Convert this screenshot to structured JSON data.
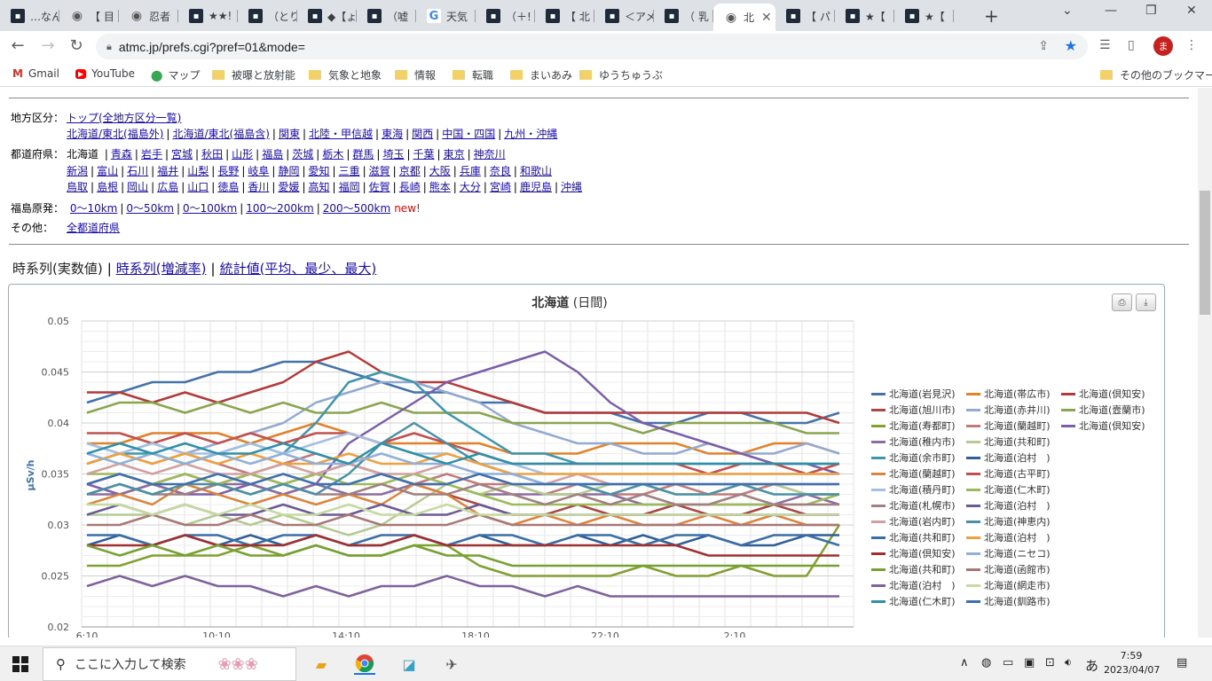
{
  "browser": {
    "tabs": [
      {
        "title": "…なん",
        "icon": "site-icon"
      },
      {
        "title": "【 目",
        "icon": "globe-icon"
      },
      {
        "title": "忍者",
        "icon": "globe-icon"
      },
      {
        "title": "★★!",
        "icon": "site-icon"
      },
      {
        "title": "（とり",
        "icon": "site-icon"
      },
      {
        "title": "◆【ょ",
        "icon": "site-icon"
      },
      {
        "title": "（嘘",
        "icon": "site-icon"
      },
      {
        "title": "天気",
        "icon": "google-icon"
      },
      {
        "title": "（＋!",
        "icon": "site-icon"
      },
      {
        "title": "【 北",
        "icon": "site-icon"
      },
      {
        "title": "＜アメ",
        "icon": "site-icon"
      },
      {
        "title": "（ 乳",
        "icon": "site-icon"
      },
      {
        "title": "北",
        "icon": "globe-icon",
        "active": true
      },
      {
        "title": "【 パ",
        "icon": "site-icon"
      },
      {
        "title": "★【",
        "icon": "site-icon"
      },
      {
        "title": "★【",
        "icon": "site-icon"
      }
    ],
    "url": "atmc.jp/prefs.cgi?pref=01&mode=",
    "avatar_initial": "ま",
    "bookmarks": [
      {
        "label": "Gmail",
        "icon": "gmail-icon"
      },
      {
        "label": "YouTube",
        "icon": "youtube-icon"
      },
      {
        "label": "マップ",
        "icon": "maps-icon"
      },
      {
        "label": "被曝と放射能",
        "icon": "folder-icon"
      },
      {
        "label": "気象と地象",
        "icon": "folder-icon"
      },
      {
        "label": "情報",
        "icon": "folder-icon"
      },
      {
        "label": "転職",
        "icon": "folder-icon"
      },
      {
        "label": "まいあみ",
        "icon": "folder-icon"
      },
      {
        "label": "ゆうちゅうぶ",
        "icon": "folder-icon"
      }
    ],
    "other_bookmarks": "その他のブックマーク"
  },
  "nav": {
    "region_label": "地方区分：",
    "region_top": "トップ(全地方区分一覧)",
    "regions": [
      "北海道/東北(福島外)",
      "北海道/東北(福島含)",
      "関東",
      "北陸・甲信越",
      "東海",
      "関西",
      "中国・四国",
      "九州・沖縄"
    ],
    "pref_label": "都道府県：",
    "pref_current": "北海道",
    "prefs_row1": [
      "青森",
      "岩手",
      "宮城",
      "秋田",
      "山形",
      "福島",
      "茨城",
      "栃木",
      "群馬",
      "埼玉",
      "千葉",
      "東京",
      "神奈川"
    ],
    "prefs_row2": [
      "新潟",
      "富山",
      "石川",
      "福井",
      "山梨",
      "長野",
      "岐阜",
      "静岡",
      "愛知",
      "三重",
      "滋賀",
      "京都",
      "大阪",
      "兵庫",
      "奈良",
      "和歌山"
    ],
    "prefs_row3": [
      "鳥取",
      "島根",
      "岡山",
      "広島",
      "山口",
      "徳島",
      "香川",
      "愛媛",
      "高知",
      "福岡",
      "佐賀",
      "長崎",
      "熊本",
      "大分",
      "宮崎",
      "鹿児島",
      "沖縄"
    ],
    "fukushima_label": "福島原発：",
    "fukushima_ranges": [
      "0〜10km",
      "0〜50km",
      "0〜100km",
      "100〜200km",
      "200〜500km"
    ],
    "new_badge": "new!",
    "other_label": "その他：",
    "other_link": "全都道府県"
  },
  "view_tabs": {
    "current": "時系列(実数値)",
    "links": [
      "時系列(増減率)",
      "統計値(平均、最少、最大)"
    ]
  },
  "chart_data": {
    "type": "line",
    "title": "北海道",
    "subtitle": "(日間)",
    "ylabel": "μSv/h",
    "ylim": [
      0.02,
      0.05
    ],
    "yticks": [
      "0.05",
      "0.045",
      "0.04",
      "0.035",
      "0.03",
      "0.025",
      "0.02"
    ],
    "xticks": [
      "6:10",
      "10:10",
      "14:10",
      "18:10",
      "22:10",
      "2:10"
    ],
    "legend_position": "right",
    "grid": true,
    "series": [
      {
        "name": "北海道(岩見沢)",
        "color": "#4572a7",
        "values": [
          0.042,
          0.043,
          0.044,
          0.044,
          0.045,
          0.045,
          0.046,
          0.046,
          0.045,
          0.044,
          0.043,
          0.043,
          0.042,
          0.042,
          0.041,
          0.041,
          0.041,
          0.04,
          0.04,
          0.041,
          0.041,
          0.04,
          0.04,
          0.041
        ]
      },
      {
        "name": "北海道(帯広市)",
        "color": "#e0822b",
        "values": [
          0.038,
          0.038,
          0.039,
          0.039,
          0.039,
          0.038,
          0.039,
          0.04,
          0.039,
          0.038,
          0.038,
          0.038,
          0.038,
          0.037,
          0.037,
          0.037,
          0.038,
          0.038,
          0.038,
          0.037,
          0.037,
          0.038,
          0.038,
          0.037
        ]
      },
      {
        "name": "北海道(倶知安)",
        "color": "#b33a3a",
        "values": [
          0.043,
          0.043,
          0.042,
          0.043,
          0.042,
          0.043,
          0.044,
          0.046,
          0.047,
          0.045,
          0.044,
          0.044,
          0.043,
          0.042,
          0.041,
          0.041,
          0.041,
          0.041,
          0.041,
          0.041,
          0.041,
          0.041,
          0.041,
          0.04
        ]
      },
      {
        "name": "北海道(旭川市)",
        "color": "#aa4643",
        "values": [
          0.034,
          0.035,
          0.034,
          0.035,
          0.034,
          0.035,
          0.034,
          0.035,
          0.036,
          0.035,
          0.034,
          0.033,
          0.032,
          0.031,
          0.031,
          0.032,
          0.031,
          0.031,
          0.032,
          0.031,
          0.031,
          0.032,
          0.031,
          0.031
        ]
      },
      {
        "name": "北海道(赤井川)",
        "color": "#93a9cf",
        "values": [
          0.038,
          0.037,
          0.038,
          0.037,
          0.038,
          0.039,
          0.04,
          0.042,
          0.043,
          0.044,
          0.044,
          0.043,
          0.042,
          0.04,
          0.039,
          0.038,
          0.038,
          0.037,
          0.037,
          0.038,
          0.037,
          0.037,
          0.038,
          0.037
        ]
      },
      {
        "name": "北海道(壼蘭市)",
        "color": "#89a54e",
        "values": [
          0.041,
          0.042,
          0.042,
          0.041,
          0.042,
          0.041,
          0.042,
          0.041,
          0.041,
          0.042,
          0.041,
          0.041,
          0.041,
          0.04,
          0.04,
          0.04,
          0.04,
          0.039,
          0.04,
          0.04,
          0.04,
          0.04,
          0.039,
          0.039
        ]
      },
      {
        "name": "北海道(寿都町)",
        "color": "#80a030",
        "values": [
          0.026,
          0.026,
          0.027,
          0.027,
          0.027,
          0.028,
          0.027,
          0.028,
          0.027,
          0.027,
          0.028,
          0.028,
          0.026,
          0.025,
          0.025,
          0.025,
          0.025,
          0.026,
          0.025,
          0.025,
          0.026,
          0.025,
          0.025,
          0.03
        ]
      },
      {
        "name": "北海道(蘭越町)",
        "color": "#c07a7a",
        "values": [
          0.036,
          0.037,
          0.036,
          0.037,
          0.036,
          0.035,
          0.036,
          0.037,
          0.036,
          0.035,
          0.034,
          0.035,
          0.034,
          0.034,
          0.033,
          0.034,
          0.033,
          0.033,
          0.034,
          0.033,
          0.033,
          0.034,
          0.033,
          0.033
        ]
      },
      {
        "name": "北海道(倶知安)",
        "color": "#7b5ea7",
        "values": [
          0.034,
          0.033,
          0.034,
          0.033,
          0.033,
          0.034,
          0.033,
          0.034,
          0.038,
          0.04,
          0.042,
          0.044,
          0.045,
          0.046,
          0.047,
          0.045,
          0.042,
          0.04,
          0.039,
          0.038,
          0.037,
          0.036,
          0.036,
          0.035
        ]
      },
      {
        "name": "北海道(稚内市)",
        "color": "#8c6d9e",
        "values": [
          0.033,
          0.033,
          0.034,
          0.033,
          0.034,
          0.034,
          0.033,
          0.034,
          0.033,
          0.033,
          0.034,
          0.034,
          0.033,
          0.033,
          0.033,
          0.033,
          0.033,
          0.032,
          0.032,
          0.032,
          0.032,
          0.032,
          0.033,
          0.032
        ]
      },
      {
        "name": "北海道(共和町)",
        "color": "#b5ca92",
        "values": [
          0.031,
          0.031,
          0.031,
          0.03,
          0.031,
          0.03,
          0.031,
          0.03,
          0.029,
          0.03,
          0.032,
          0.034,
          0.033,
          0.034,
          0.033,
          0.033,
          0.034,
          0.034,
          0.033,
          0.033,
          0.034,
          0.034,
          0.033,
          0.033
        ]
      },
      {
        "name": "北海道(余市町)",
        "color": "#3d96ae",
        "values": [
          0.036,
          0.037,
          0.037,
          0.036,
          0.037,
          0.038,
          0.037,
          0.04,
          0.044,
          0.045,
          0.044,
          0.041,
          0.039,
          0.037,
          0.037,
          0.036,
          0.036,
          0.036,
          0.036,
          0.036,
          0.036,
          0.036,
          0.036,
          0.036
        ]
      },
      {
        "name": "北海道(泊村　)",
        "color": "#2f5f98",
        "values": [
          0.028,
          0.029,
          0.028,
          0.029,
          0.028,
          0.029,
          0.028,
          0.029,
          0.028,
          0.028,
          0.029,
          0.028,
          0.029,
          0.028,
          0.028,
          0.029,
          0.028,
          0.029,
          0.028,
          0.029,
          0.028,
          0.028,
          0.029,
          0.029
        ]
      },
      {
        "name": "北海道(蘭越町)",
        "color": "#db843d",
        "values": [
          0.032,
          0.033,
          0.032,
          0.034,
          0.033,
          0.032,
          0.033,
          0.032,
          0.033,
          0.032,
          0.034,
          0.033,
          0.031,
          0.03,
          0.031,
          0.03,
          0.031,
          0.03,
          0.03,
          0.031,
          0.03,
          0.031,
          0.03,
          0.03
        ]
      },
      {
        "name": "北海道(古平町)",
        "color": "#c0504d",
        "values": [
          0.039,
          0.039,
          0.038,
          0.039,
          0.038,
          0.039,
          0.038,
          0.039,
          0.039,
          0.038,
          0.039,
          0.038,
          0.037,
          0.036,
          0.036,
          0.036,
          0.036,
          0.036,
          0.036,
          0.035,
          0.036,
          0.036,
          0.035,
          0.036
        ]
      },
      {
        "name": "北海道(積丹町)",
        "color": "#a4bfe0",
        "values": [
          0.038,
          0.037,
          0.038,
          0.037,
          0.037,
          0.038,
          0.037,
          0.038,
          0.039,
          0.038,
          0.037,
          0.037,
          0.036,
          0.036,
          0.035,
          0.035,
          0.035,
          0.035,
          0.035,
          0.035,
          0.035,
          0.035,
          0.035,
          0.035
        ]
      },
      {
        "name": "北海道(仁木町)",
        "color": "#9bbb59",
        "values": [
          0.035,
          0.035,
          0.034,
          0.035,
          0.034,
          0.035,
          0.034,
          0.035,
          0.034,
          0.034,
          0.035,
          0.034,
          0.033,
          0.032,
          0.032,
          0.032,
          0.032,
          0.032,
          0.032,
          0.032,
          0.032,
          0.032,
          0.032,
          0.033
        ]
      },
      {
        "name": "北海道(札幌市)",
        "color": "#a08080",
        "values": [
          0.033,
          0.034,
          0.033,
          0.033,
          0.034,
          0.033,
          0.034,
          0.033,
          0.033,
          0.034,
          0.033,
          0.033,
          0.034,
          0.033,
          0.032,
          0.033,
          0.032,
          0.033,
          0.032,
          0.032,
          0.033,
          0.032,
          0.032,
          0.032
        ]
      },
      {
        "name": "北海道(泊村　)",
        "color": "#6c5a96",
        "values": [
          0.031,
          0.032,
          0.031,
          0.032,
          0.031,
          0.031,
          0.032,
          0.031,
          0.031,
          0.032,
          0.031,
          0.031,
          0.032,
          0.031,
          0.031,
          0.031,
          0.031,
          0.031,
          0.031,
          0.031,
          0.031,
          0.031,
          0.031,
          0.031
        ]
      },
      {
        "name": "北海道(岩内町)",
        "color": "#d0a0a0",
        "values": [
          0.035,
          0.036,
          0.035,
          0.036,
          0.035,
          0.035,
          0.036,
          0.035,
          0.036,
          0.035,
          0.035,
          0.036,
          0.035,
          0.034,
          0.034,
          0.035,
          0.034,
          0.034,
          0.034,
          0.034,
          0.034,
          0.034,
          0.034,
          0.034
        ]
      },
      {
        "name": "北海道(神恵内)",
        "color": "#4a90a4",
        "values": [
          0.033,
          0.034,
          0.033,
          0.034,
          0.034,
          0.033,
          0.034,
          0.033,
          0.035,
          0.038,
          0.04,
          0.038,
          0.036,
          0.035,
          0.034,
          0.034,
          0.033,
          0.034,
          0.033,
          0.033,
          0.034,
          0.033,
          0.033,
          0.033
        ]
      },
      {
        "name": "北海道(共和町)",
        "color": "#3a6ea5",
        "values": [
          0.029,
          0.029,
          0.028,
          0.029,
          0.029,
          0.028,
          0.029,
          0.029,
          0.028,
          0.029,
          0.029,
          0.028,
          0.029,
          0.029,
          0.028,
          0.029,
          0.029,
          0.028,
          0.029,
          0.029,
          0.028,
          0.029,
          0.029,
          0.028
        ]
      },
      {
        "name": "北海道(泊村　)",
        "color": "#f0a040",
        "values": [
          0.036,
          0.037,
          0.036,
          0.037,
          0.036,
          0.037,
          0.036,
          0.036,
          0.037,
          0.036,
          0.036,
          0.037,
          0.036,
          0.035,
          0.035,
          0.035,
          0.035,
          0.035,
          0.035,
          0.035,
          0.035,
          0.035,
          0.035,
          0.035
        ]
      },
      {
        "name": "北海道(倶知安)",
        "color": "#a03030",
        "values": [
          0.028,
          0.028,
          0.028,
          0.029,
          0.028,
          0.028,
          0.028,
          0.029,
          0.028,
          0.028,
          0.029,
          0.028,
          0.028,
          0.028,
          0.028,
          0.028,
          0.028,
          0.028,
          0.028,
          0.027,
          0.027,
          0.027,
          0.027,
          0.027
        ]
      },
      {
        "name": "北海道(ニセコ)",
        "color": "#8fb0d8",
        "values": [
          0.037,
          0.036,
          0.037,
          0.036,
          0.037,
          0.036,
          0.037,
          0.036,
          0.036,
          0.037,
          0.036,
          0.036,
          0.035,
          0.035,
          0.034,
          0.034,
          0.034,
          0.034,
          0.034,
          0.034,
          0.034,
          0.034,
          0.034,
          0.034
        ]
      },
      {
        "name": "北海道(共和町)",
        "color": "#77a033",
        "values": [
          0.028,
          0.027,
          0.028,
          0.027,
          0.028,
          0.027,
          0.027,
          0.028,
          0.027,
          0.027,
          0.028,
          0.027,
          0.027,
          0.026,
          0.026,
          0.026,
          0.026,
          0.026,
          0.026,
          0.026,
          0.026,
          0.026,
          0.026,
          0.026
        ]
      },
      {
        "name": "北海道(函館市)",
        "color": "#a87878",
        "values": [
          0.03,
          0.03,
          0.031,
          0.03,
          0.03,
          0.031,
          0.03,
          0.03,
          0.031,
          0.03,
          0.03,
          0.03,
          0.031,
          0.03,
          0.03,
          0.03,
          0.03,
          0.03,
          0.03,
          0.03,
          0.03,
          0.03,
          0.03,
          0.03
        ]
      },
      {
        "name": "北海道(泊村　)",
        "color": "#7d629e",
        "values": [
          0.024,
          0.025,
          0.024,
          0.025,
          0.024,
          0.024,
          0.023,
          0.024,
          0.023,
          0.024,
          0.024,
          0.025,
          0.024,
          0.024,
          0.023,
          0.024,
          0.023,
          0.023,
          0.023,
          0.023,
          0.023,
          0.023,
          0.023,
          0.023
        ]
      },
      {
        "name": "北海道(網走市)",
        "color": "#c6d9a0",
        "values": [
          0.032,
          0.032,
          0.031,
          0.032,
          0.031,
          0.032,
          0.031,
          0.031,
          0.032,
          0.031,
          0.031,
          0.032,
          0.031,
          0.031,
          0.031,
          0.031,
          0.031,
          0.031,
          0.031,
          0.031,
          0.031,
          0.031,
          0.031,
          0.031
        ]
      },
      {
        "name": "北海道(仁木町)",
        "color": "#2e8fa8",
        "values": [
          0.037,
          0.038,
          0.037,
          0.038,
          0.037,
          0.037,
          0.038,
          0.037,
          0.036,
          0.038,
          0.037,
          0.036,
          0.037,
          0.036,
          0.036,
          0.036,
          0.036,
          0.036,
          0.036,
          0.036,
          0.036,
          0.036,
          0.036,
          0.036
        ]
      },
      {
        "name": "北海道(釧路市)",
        "color": "#3f6fae",
        "values": [
          0.034,
          0.035,
          0.034,
          0.034,
          0.035,
          0.034,
          0.035,
          0.034,
          0.034,
          0.035,
          0.034,
          0.034,
          0.035,
          0.034,
          0.034,
          0.034,
          0.034,
          0.034,
          0.034,
          0.034,
          0.034,
          0.034,
          0.034,
          0.034
        ]
      }
    ]
  },
  "taskbar": {
    "search_placeholder": "ここに入力して検索",
    "time": "7:59",
    "date": "2023/04/07",
    "ime": "あ"
  }
}
